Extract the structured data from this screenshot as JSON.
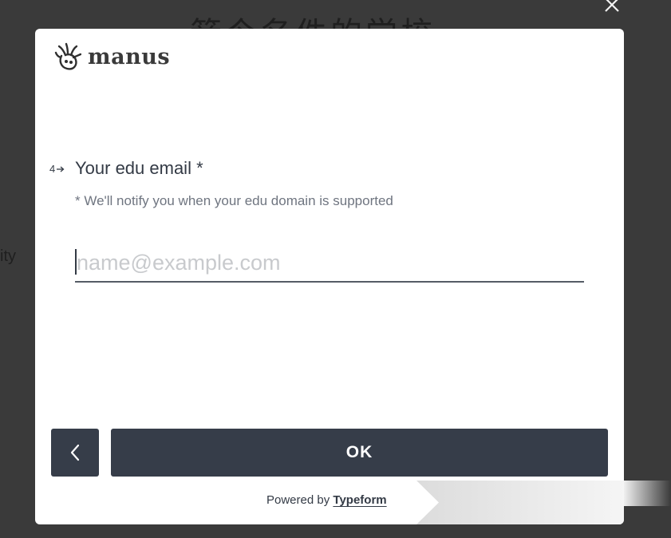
{
  "backdrop": {
    "heading": "箭今名件的学校",
    "side_text": "ity"
  },
  "modal": {
    "brand": {
      "name": "manus",
      "logo_icon": "manus-logo-icon"
    },
    "question": {
      "number": "4",
      "arrow_icon": "arrow-right-icon",
      "title": "Your edu email *",
      "description": "* We'll notify you when your edu domain is supported",
      "input_value": "",
      "input_placeholder": "name@example.com"
    },
    "navigation": {
      "back_icon": "chevron-left-icon",
      "ok_label": "OK"
    },
    "footer": {
      "powered_by": "Powered by",
      "brand_link": "Typeform"
    }
  },
  "close_icon": "close-icon",
  "colors": {
    "button_bg": "#363d49",
    "text": "#333a45",
    "muted_text": "#6f7580",
    "placeholder": "#c8cacd",
    "overlay": "#3a3a3a"
  }
}
